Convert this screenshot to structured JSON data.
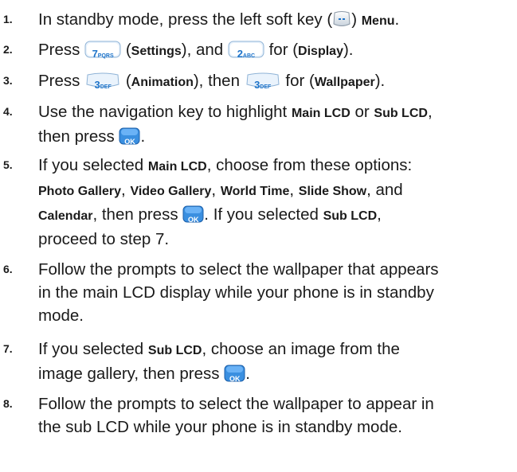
{
  "steps": [
    {
      "num": "1.",
      "lead": "In standby mode, press the left soft key (",
      "menu_close": ")",
      "menu": "Menu",
      "end": "."
    },
    {
      "num": "2.",
      "press": "Press",
      "open1": "(",
      "settings": "Settings",
      "close1": "), and",
      "for": "for (",
      "display": "Display",
      "close2": ")."
    },
    {
      "num": "3.",
      "press": "Press",
      "open1": "(",
      "animation": "Animation",
      "close1": "), then",
      "for": "for (",
      "wallpaper": "Wallpaper",
      "close2": ")."
    },
    {
      "num": "4.",
      "line1": "Use the navigation key to highlight",
      "main_lcd": "Main LCD",
      "or": "or",
      "sub_lcd": "Sub LCD",
      "comma": ",",
      "line2": "then press",
      "end": "."
    },
    {
      "num": "5.",
      "a": "If you selected",
      "main_lcd": "Main LCD",
      "b": ", choose from these options:",
      "photo": "Photo Gallery",
      "c1": ",",
      "video": "Video Gallery",
      "c2": ",",
      "world": "World Time",
      "c3": ",",
      "slide": "Slide Show",
      "c4": ", and",
      "calendar": "Calendar",
      "d": ", then press",
      "e": ". If you selected",
      "sub_lcd": "Sub LCD",
      "f": ",",
      "g": "proceed to step 7."
    },
    {
      "num": "6.",
      "l1": "Follow the prompts to select the wallpaper that appears",
      "l2": "in the main LCD display while your phone is in standby",
      "l3": "mode."
    },
    {
      "num": "7.",
      "a": "If you selected",
      "sub_lcd": "Sub LCD",
      "b": ", choose an image from the",
      "c": "image gallery, then press",
      "end": "."
    },
    {
      "num": "8.",
      "l1": "Follow the prompts to select the wallpaper to appear in",
      "l2": "the sub LCD while your phone is in standby mode."
    }
  ],
  "keys": {
    "k7": {
      "digit": "7",
      "letters": "PQRS"
    },
    "k2": {
      "digit": "2",
      "letters": "ABC"
    },
    "k3": {
      "digit": "3",
      "letters": "DEF"
    },
    "ok": "OK"
  },
  "colors": {
    "key_blue": "#2f86dd",
    "key_border": "#8fb3d6",
    "ok_bg": "#3a8fe0"
  }
}
